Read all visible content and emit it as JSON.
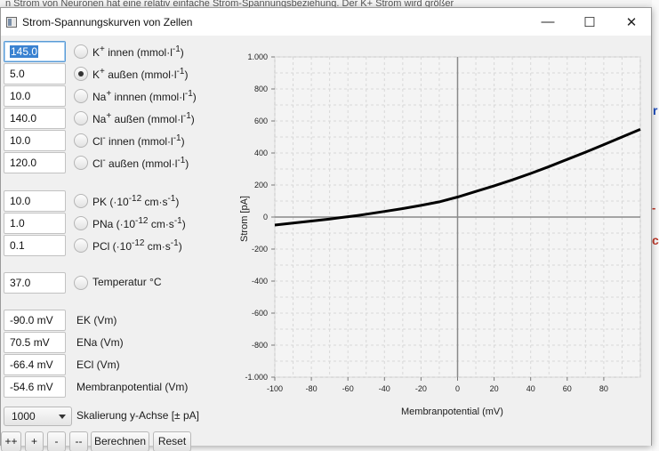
{
  "window": {
    "title": "Strom-Spannungskurven von Zellen",
    "controls": {
      "minimize": "—",
      "maximize": "☐",
      "close": "✕"
    }
  },
  "background": {
    "top_text": "n Strom von Neuronen hat eine relativ einfache Strom-Spannungsbeziehung. Der K+ Strom wird größer",
    "marks": [
      "-",
      "c",
      "r"
    ]
  },
  "concentrations": [
    {
      "value": "145.0",
      "label_main": "K",
      "label_sup": "+",
      "label_rest": " innen (mmol·l",
      "unit_sup": "-1",
      "label_end": ")",
      "selected": false
    },
    {
      "value": "5.0",
      "label_main": "K",
      "label_sup": "+",
      "label_rest": " außen  (mmol·l",
      "unit_sup": "-1",
      "label_end": ")",
      "selected": true
    },
    {
      "value": "10.0",
      "label_main": "Na",
      "label_sup": "+",
      "label_rest": " innnen (mmol·l",
      "unit_sup": "-1",
      "label_end": ")",
      "selected": false
    },
    {
      "value": "140.0",
      "label_main": "Na",
      "label_sup": "+",
      "label_rest": " außen  (mmol·l",
      "unit_sup": "-1",
      "label_end": ")",
      "selected": false
    },
    {
      "value": "10.0",
      "label_main": "Cl",
      "label_sup": "-",
      "label_rest": " innen  (mmol·l",
      "unit_sup": "-1",
      "label_end": ")",
      "selected": false
    },
    {
      "value": "120.0",
      "label_main": "Cl",
      "label_sup": "-",
      "label_rest": " außen  (mmol·l",
      "unit_sup": "-1",
      "label_end": ")",
      "selected": false
    }
  ],
  "permeabilities": [
    {
      "value": "10.0",
      "label_main": "PK  (·10",
      "label_sup": "-12",
      "label_rest": " cm·s",
      "unit_sup": "-1",
      "label_end": ")",
      "selected": false
    },
    {
      "value": "1.0",
      "label_main": "PNa (·10",
      "label_sup": "-12",
      "label_rest": " cm·s",
      "unit_sup": "-1",
      "label_end": ")",
      "selected": false
    },
    {
      "value": "0.1",
      "label_main": "PCl (·10",
      "label_sup": "-12",
      "label_rest": " cm·s",
      "unit_sup": "-1",
      "label_end": ")",
      "selected": false
    }
  ],
  "temperature": {
    "value": "37.0",
    "label": "Temperatur °C",
    "selected": false
  },
  "potentials": [
    {
      "value": "-90.0 mV",
      "label": "EK (Vm)"
    },
    {
      "value": "70.5 mV",
      "label": "ENa (Vm)"
    },
    {
      "value": "-66.4 mV",
      "label": "ECl (Vm)"
    },
    {
      "value": "-54.6 mV",
      "label": "Membranpotential (Vm)"
    }
  ],
  "scale": {
    "selected": "1000",
    "label": "Skalierung y-Achse [± pA]"
  },
  "buttons": {
    "plusplus": "++",
    "plus": "+",
    "minus": "-",
    "minusminus": "--",
    "calculate": "Berechnen",
    "reset": "Reset"
  },
  "colors": {
    "curve": "#000000",
    "axis": "#8a8a8a",
    "grid": "#d8d8d8",
    "selection": "#3a82d1",
    "focus": "#5a9bd5"
  },
  "chart_data": {
    "type": "line",
    "xlabel": "Membranpotential (mV)",
    "ylabel": "Strom [pA]",
    "xlim": [
      -100,
      100
    ],
    "ylim": [
      -1000,
      1000
    ],
    "xticks": [
      -100,
      -80,
      -60,
      -40,
      -20,
      0,
      20,
      40,
      60,
      80
    ],
    "yticks": [
      1000,
      800,
      600,
      400,
      200,
      0,
      -200,
      -400,
      -600,
      -800,
      -1000
    ],
    "ytick_labels": [
      "1.000",
      "800",
      "600",
      "400",
      "200",
      "0",
      "-200",
      "-400",
      "-600",
      "-800",
      "-1.000"
    ],
    "grid": true,
    "series": [
      {
        "x": [
          -100,
          -90,
          -80,
          -70,
          -60,
          -54.6,
          -50,
          -40,
          -30,
          -20,
          -10,
          0,
          10,
          20,
          30,
          40,
          50,
          60,
          70,
          80,
          90,
          100
        ],
        "y": [
          -50,
          -38,
          -25,
          -12,
          2,
          10,
          18,
          35,
          53,
          73,
          95,
          125,
          160,
          195,
          232,
          272,
          315,
          360,
          405,
          452,
          500,
          548
        ]
      }
    ]
  }
}
